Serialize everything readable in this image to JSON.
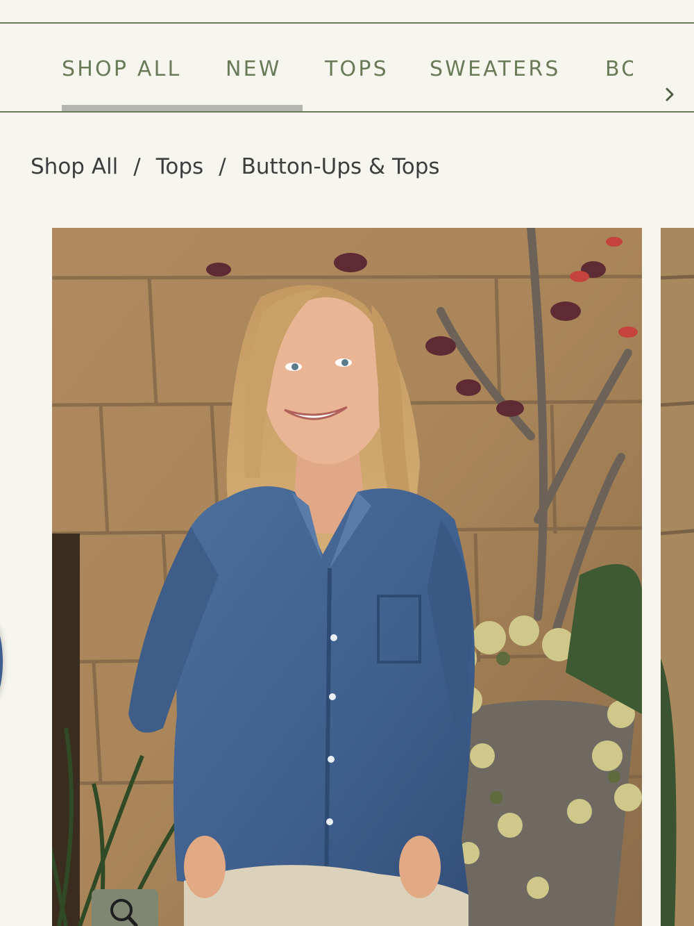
{
  "nav": {
    "categories": [
      {
        "label": "SHOP ALL",
        "active": true
      },
      {
        "label": "NEW",
        "active": false
      },
      {
        "label": "TOPS",
        "active": false
      },
      {
        "label": "SWEATERS",
        "active": false
      },
      {
        "label": "BO",
        "active": false
      }
    ],
    "next_icon": "chevron-right-icon"
  },
  "breadcrumb": {
    "items": [
      "Shop All",
      "Tops",
      "Button-Ups & Tops"
    ],
    "separator": "/"
  },
  "product": {
    "zoom_icon": "magnifier-icon"
  },
  "colors": {
    "background": "#f6f6ef",
    "nav_text": "#697a58",
    "nav_rule": "#6b7a5a",
    "active_indicator": "#b4b4b0",
    "breadcrumb_text": "#3d3d3d",
    "zoom_button": "#7f8671"
  }
}
